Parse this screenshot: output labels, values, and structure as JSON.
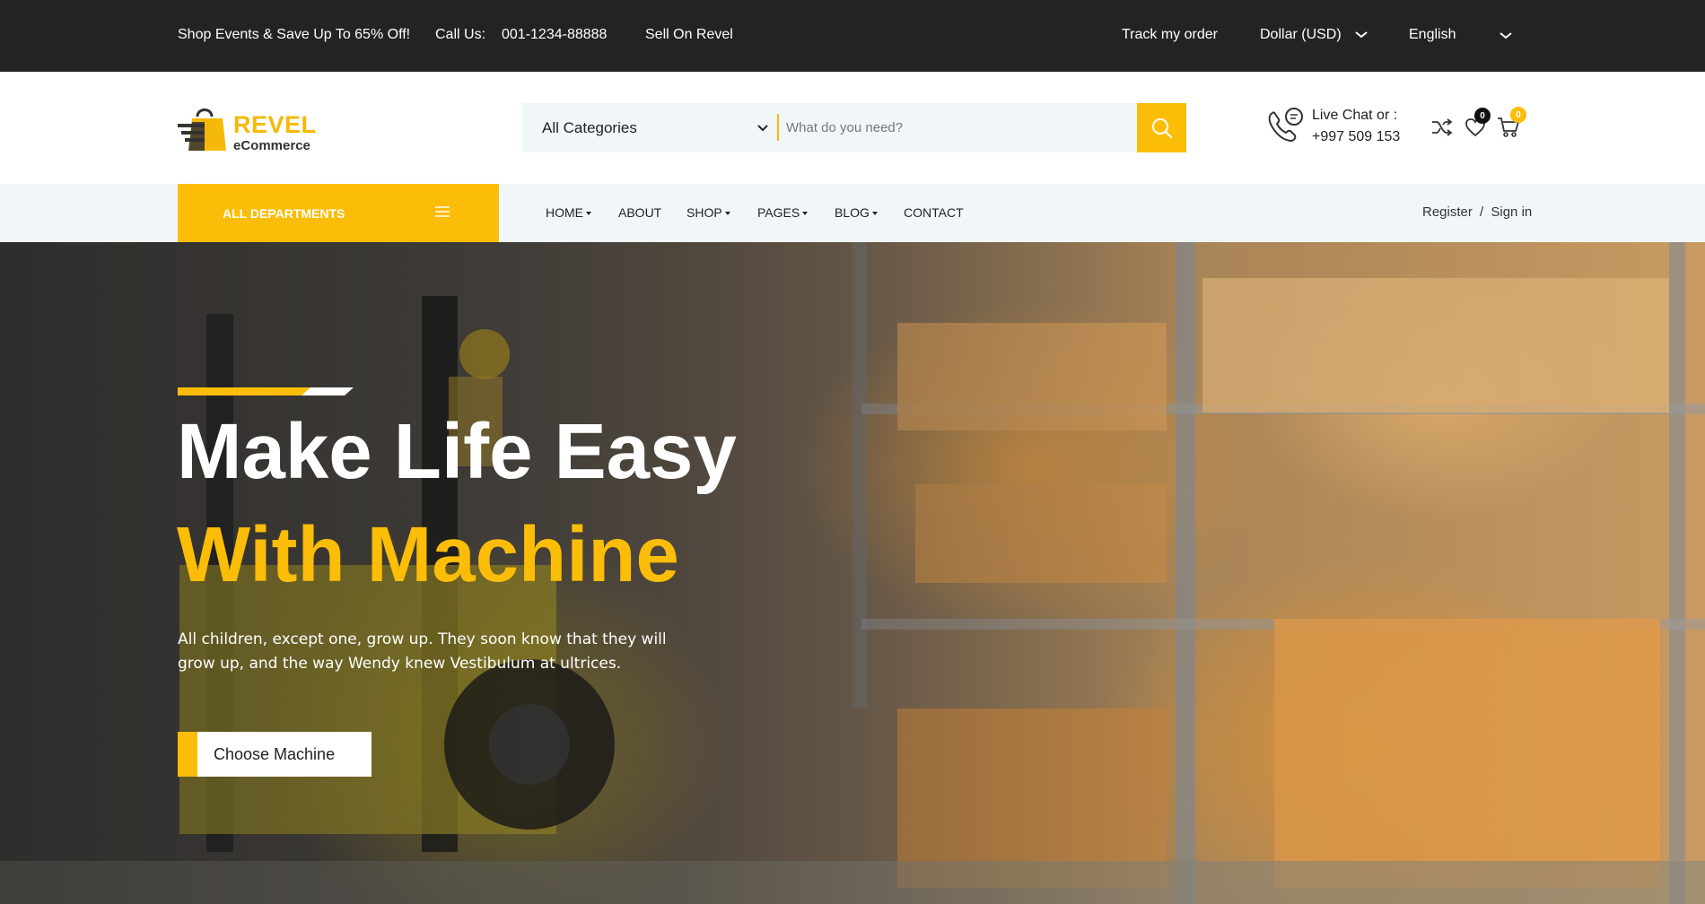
{
  "topbar": {
    "promo": "Shop Events & Save Up To 65% Off!",
    "call_label": "Call Us:",
    "phone": "001-1234-88888",
    "sell": "Sell On Revel",
    "track": "Track my order",
    "currency": "Dollar (USD)",
    "language": "English"
  },
  "logo": {
    "brand": "REVEL",
    "sub": "eCommerce"
  },
  "search": {
    "category": "All Categories",
    "placeholder": "What do you need?"
  },
  "contact": {
    "line1": "Live Chat or :",
    "line2": "+997 509 153"
  },
  "header_icons": {
    "wishlist_count": "0",
    "cart_count": "0"
  },
  "navbar": {
    "departments": "ALL DEPARTMENTS",
    "items": [
      "HOME",
      "ABOUT",
      "SHOP",
      "PAGES",
      "BLOG",
      "CONTACT"
    ],
    "register": "Register",
    "separator": "/",
    "signin": "Sign in"
  },
  "hero": {
    "title_line1": "Make Life Easy",
    "title_line2": "With Machine",
    "description": "All children, except one, grow up. They soon know that they will grow up, and the way Wendy knew Vestibulum at ultrices.",
    "cta": "Choose Machine"
  },
  "colors": {
    "accent": "#fbbd08",
    "topbar": "#232323",
    "nav_bg": "#f1f7f9"
  }
}
